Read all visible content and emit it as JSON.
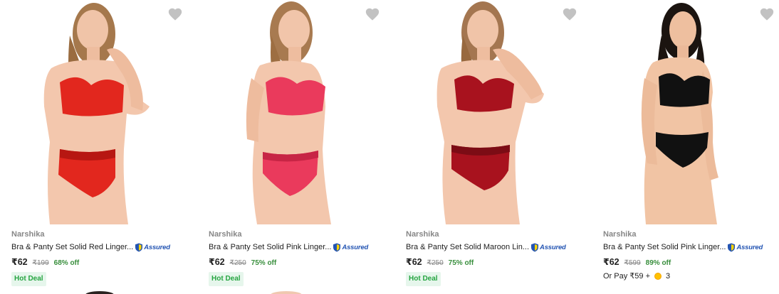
{
  "products": [
    {
      "brand": "Narshika",
      "title": "Bra & Panty Set Solid Red Linger...",
      "assured": "Assured",
      "price": "₹62",
      "mrp": "₹199",
      "discount": "68% off",
      "badge": "Hot Deal",
      "colors": {
        "set": "#e2271e",
        "setDark": "#b71712"
      }
    },
    {
      "brand": "Narshika",
      "title": "Bra & Panty Set Solid Pink Linger...",
      "assured": "Assured",
      "price": "₹62",
      "mrp": "₹250",
      "discount": "75% off",
      "badge": "Hot Deal",
      "colors": {
        "set": "#ea3a5c",
        "setDark": "#c72545"
      }
    },
    {
      "brand": "Narshika",
      "title": "Bra & Panty Set Solid Maroon Lin...",
      "assured": "Assured",
      "price": "₹62",
      "mrp": "₹250",
      "discount": "75% off",
      "badge": "Hot Deal",
      "colors": {
        "set": "#a8121e",
        "setDark": "#7c0c15"
      }
    },
    {
      "brand": "Narshika",
      "title": "Bra & Panty Set Solid Pink Linger...",
      "assured": "Assured",
      "price": "₹62",
      "mrp": "₹599",
      "discount": "89% off",
      "or_pay": "Or Pay ₹59 +",
      "coins": "3",
      "colors": {
        "set": "#111111",
        "setDark": "#000000"
      }
    }
  ],
  "icons": {
    "wishlist": "heart-icon",
    "assured": "shield-icon",
    "coin": "supercoin-icon"
  }
}
